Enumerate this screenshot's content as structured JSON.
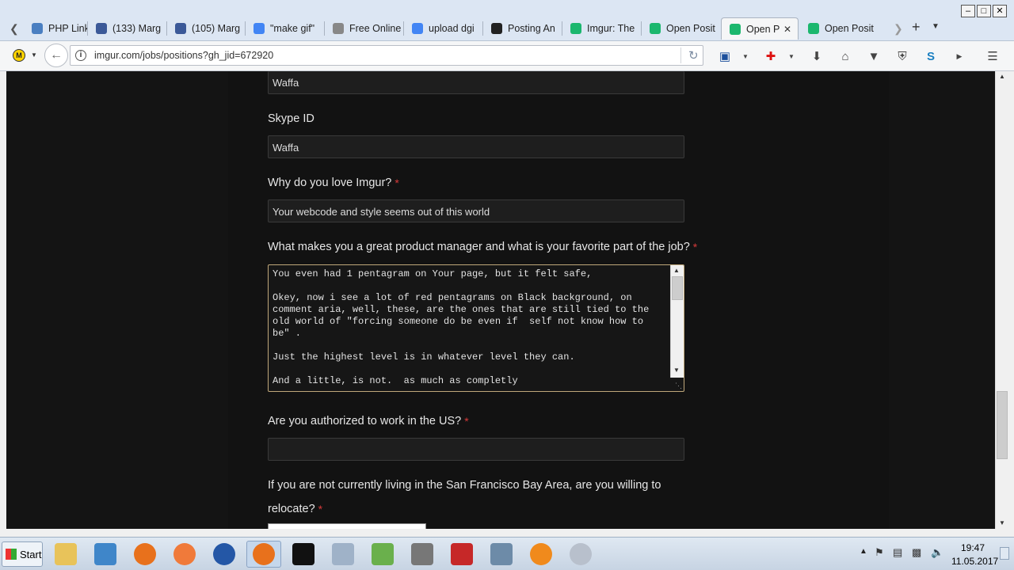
{
  "tabs": [
    {
      "label": "PHP Link D",
      "icon": "page-icon",
      "color": "#4a7fc1"
    },
    {
      "label": "(133) Marg",
      "icon": "facebook-icon",
      "color": "#3b5998"
    },
    {
      "label": "(105) Marg",
      "icon": "facebook-icon",
      "color": "#3b5998"
    },
    {
      "label": "\"make gif\"",
      "icon": "google-icon",
      "color": "#4285f4"
    },
    {
      "label": "Free Online An",
      "icon": "page-icon",
      "color": "#888888"
    },
    {
      "label": "upload dgi",
      "icon": "google-icon",
      "color": "#4285f4"
    },
    {
      "label": "Posting An",
      "icon": "nyt-icon",
      "color": "#222222"
    },
    {
      "label": "Imgur: The",
      "icon": "imgur-icon",
      "color": "#1bb76e"
    },
    {
      "label": "Open Posit",
      "icon": "imgur-icon",
      "color": "#1bb76e"
    },
    {
      "label": "Open P",
      "icon": "imgur-icon",
      "color": "#1bb76e",
      "active": true
    },
    {
      "label": "Open Posit",
      "icon": "imgur-icon",
      "color": "#1bb76e"
    }
  ],
  "nav": {
    "url": "imgur.com/jobs/positions?gh_jid=672920"
  },
  "form": {
    "field_top_value": "Waffa",
    "skype_label": "Skype ID",
    "skype_value": "Waffa",
    "love_label": "Why do you love Imgur?",
    "love_value": "Your webcode and style seems out of this world",
    "pm_label": "What makes you a great product manager and what is your favorite part of the job?",
    "pm_text": "You even had 1 pentagram on Your page, but it felt safe,\n\nOkey, now i see a lot of red pentagrams on Black background, on comment aria, well, these, are the ones that are still tied to the old world of \"forcing someone do be even if  self not know how to be\" .\n\nJust the highest level is in whatever level they can.\n\nAnd a little, is not.  as much as completly",
    "auth_label": "Are you authorized to work in the US?",
    "auth_value": "",
    "relocate_label_1": "If you are not currently living in the San Francisco Bay Area, are you willing to",
    "relocate_label_2": "relocate?",
    "required_mark": "*"
  },
  "taskbar": {
    "start_label": "Start",
    "time": "19:47",
    "date": "11.05.2017"
  },
  "colors": {
    "required": "#d63a3a",
    "page_bg": "#141414",
    "accent": "#1bb76e"
  }
}
